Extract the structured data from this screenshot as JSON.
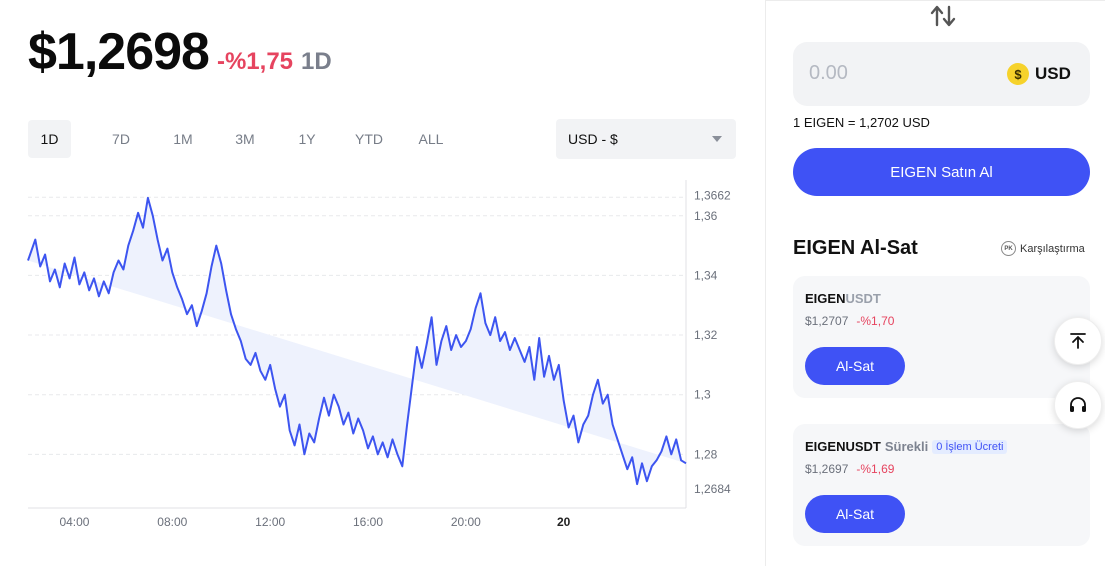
{
  "header": {
    "price": "$1,2698",
    "change": "-%1,75",
    "period": "1D"
  },
  "ranges": [
    {
      "label": "1D",
      "active": true
    },
    {
      "label": "7D",
      "active": false
    },
    {
      "label": "1M",
      "active": false
    },
    {
      "label": "3M",
      "active": false
    },
    {
      "label": "1Y",
      "active": false
    },
    {
      "label": "YTD",
      "active": false
    },
    {
      "label": "ALL",
      "active": false
    }
  ],
  "currency_select": {
    "selected": "USD - $"
  },
  "chart_data": {
    "type": "area",
    "x_ticks": [
      "04:00",
      "08:00",
      "12:00",
      "16:00",
      "20:00",
      "20"
    ],
    "y_ticks": [
      "1,28",
      "1,3",
      "1,32",
      "1,34",
      "1,36"
    ],
    "y_high_label": "1,3662",
    "y_low_label": "1,2684",
    "ylim": [
      1.262,
      1.372
    ],
    "x_hours": [
      0,
      0.3,
      0.5,
      0.7,
      0.9,
      1.1,
      1.3,
      1.5,
      1.7,
      1.9,
      2.1,
      2.3,
      2.5,
      2.7,
      2.9,
      3.1,
      3.3,
      3.5,
      3.7,
      3.9,
      4.1,
      4.3,
      4.5,
      4.7,
      4.9,
      5.1,
      5.3,
      5.5,
      5.7,
      5.9,
      6.1,
      6.3,
      6.5,
      6.7,
      6.9,
      7.1,
      7.3,
      7.5,
      7.7,
      7.9,
      8.1,
      8.3,
      8.5,
      8.7,
      8.9,
      9.1,
      9.3,
      9.5,
      9.7,
      9.9,
      10.1,
      10.3,
      10.5,
      10.7,
      10.9,
      11.1,
      11.3,
      11.5,
      11.7,
      11.9,
      12.1,
      12.3,
      12.5,
      12.7,
      12.9,
      13.1,
      13.3,
      13.5,
      13.7,
      13.9,
      14.1,
      14.3,
      14.5,
      14.7,
      14.9,
      15.1,
      15.3,
      15.5,
      15.7,
      15.9,
      16.1,
      16.3,
      16.5,
      16.7,
      16.9,
      17.1,
      17.3,
      17.5,
      17.7,
      17.9,
      18.1,
      18.3,
      18.5,
      18.7,
      18.9,
      19.1,
      19.3,
      19.5,
      19.7,
      19.9,
      20.1,
      20.3,
      20.5,
      20.7,
      20.9,
      21.1,
      21.3,
      21.5,
      21.7,
      21.9,
      22.1,
      22.3,
      22.5,
      22.7,
      22.9,
      23.1,
      23.3,
      23.5,
      23.7,
      23.9,
      24.1,
      24.3,
      24.5,
      24.7,
      24.9,
      25.1,
      25.3,
      25.5,
      25.7,
      25.9,
      26.1,
      26.3,
      26.5,
      26.7,
      26.9
    ],
    "values": [
      1.345,
      1.352,
      1.343,
      1.347,
      1.338,
      1.342,
      1.336,
      1.344,
      1.339,
      1.346,
      1.337,
      1.341,
      1.335,
      1.339,
      1.333,
      1.338,
      1.334,
      1.341,
      1.345,
      1.342,
      1.35,
      1.355,
      1.361,
      1.356,
      1.366,
      1.36,
      1.352,
      1.345,
      1.349,
      1.341,
      1.336,
      1.332,
      1.327,
      1.33,
      1.323,
      1.328,
      1.334,
      1.343,
      1.35,
      1.344,
      1.335,
      1.327,
      1.322,
      1.318,
      1.312,
      1.31,
      1.314,
      1.308,
      1.305,
      1.31,
      1.302,
      1.296,
      1.3,
      1.288,
      1.283,
      1.29,
      1.28,
      1.287,
      1.284,
      1.292,
      1.299,
      1.293,
      1.3,
      1.296,
      1.29,
      1.294,
      1.287,
      1.292,
      1.288,
      1.282,
      1.286,
      1.28,
      1.284,
      1.279,
      1.285,
      1.28,
      1.276,
      1.29,
      1.303,
      1.316,
      1.309,
      1.317,
      1.326,
      1.31,
      1.318,
      1.323,
      1.315,
      1.32,
      1.316,
      1.318,
      1.322,
      1.329,
      1.334,
      1.324,
      1.32,
      1.326,
      1.318,
      1.321,
      1.315,
      1.319,
      1.315,
      1.311,
      1.316,
      1.305,
      1.319,
      1.306,
      1.313,
      1.305,
      1.31,
      1.298,
      1.289,
      1.293,
      1.284,
      1.29,
      1.293,
      1.3,
      1.305,
      1.297,
      1.3,
      1.29,
      1.285,
      1.28,
      1.275,
      1.279,
      1.27,
      1.277,
      1.271,
      1.276,
      1.278,
      1.281,
      1.286,
      1.28,
      1.285,
      1.278,
      1.277,
      1.269
    ],
    "series": [
      {
        "color": "#3d55f0",
        "fill": "#eef2fd"
      }
    ]
  },
  "right": {
    "amount": {
      "placeholder": "0.00",
      "currency": "USD",
      "coin_symbol": "$"
    },
    "rate": "1 EIGEN = 1,2702 USD",
    "buy_label": "EIGEN Satın Al",
    "section_title": "EIGEN Al-Sat",
    "compare_label": "Karşılaştırma",
    "compare_icon_text": "PK",
    "cards": [
      {
        "base": "EIGEN",
        "quote": "USDT",
        "perp": "",
        "fee": "",
        "price": "$1,2707",
        "change": "-%1,70",
        "button": "Al-Sat"
      },
      {
        "base": "EIGENUSDT",
        "quote": "",
        "perp": "Sürekli",
        "fee": "0 İşlem Ücreti",
        "price": "$1,2697",
        "change": "-%1,69",
        "button": "Al-Sat"
      }
    ]
  },
  "colors": {
    "accent": "#3f52f5",
    "negative": "#e6445f",
    "line": "#3d55f0"
  }
}
